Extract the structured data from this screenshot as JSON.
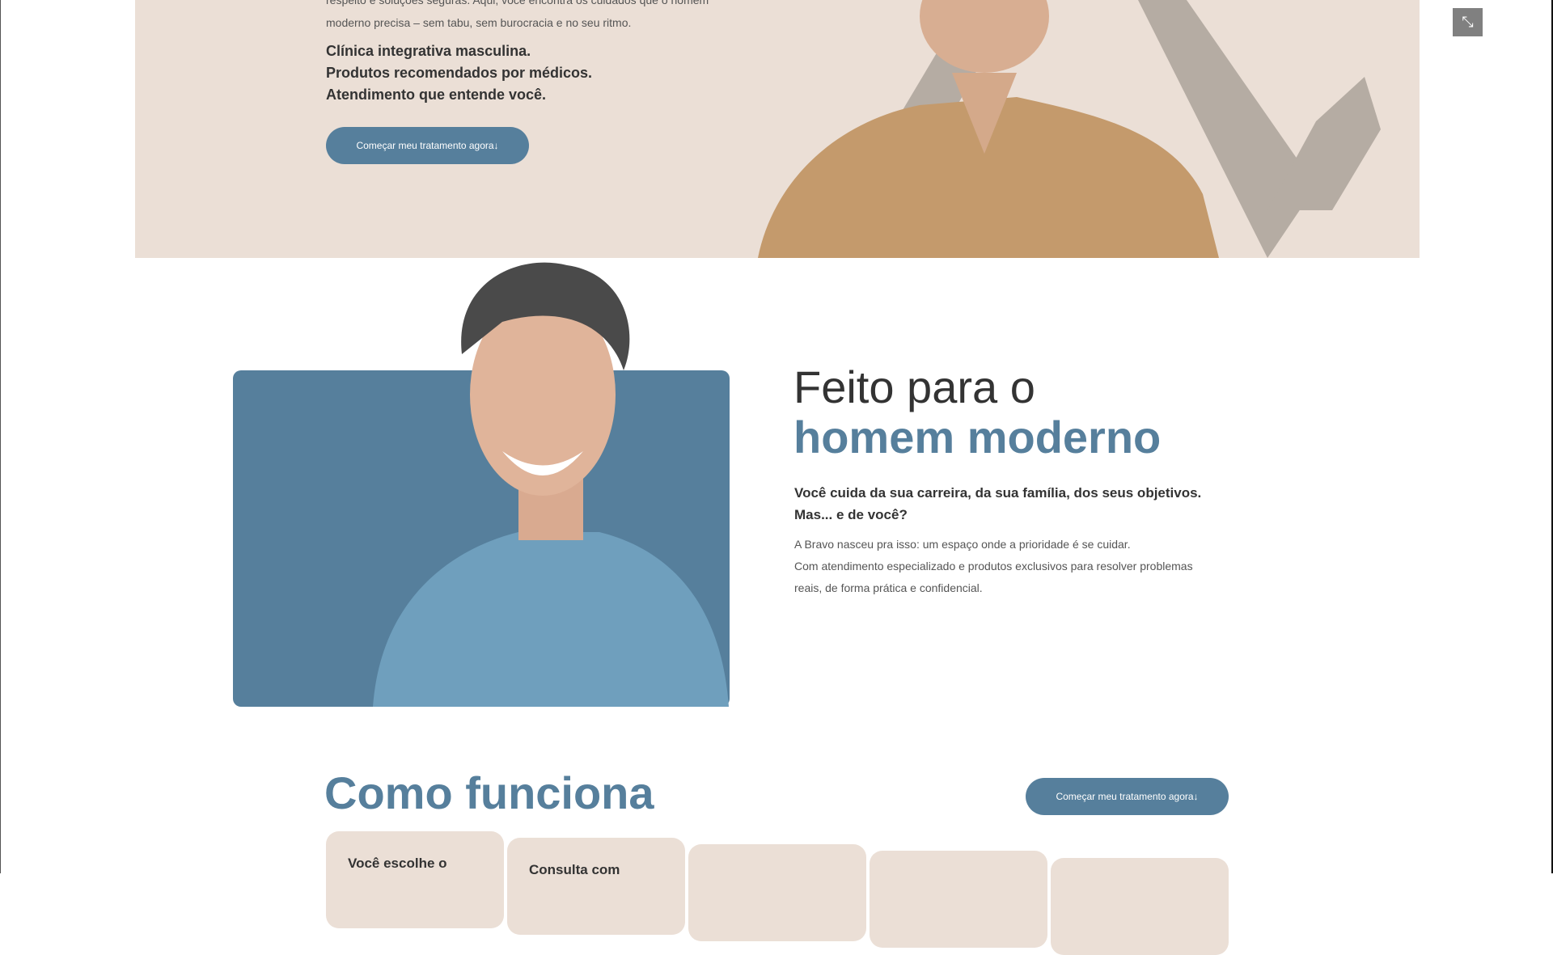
{
  "hero": {
    "intro_lines": [
      "respeito e soluções seguras. Aqui, você encontra os cuidados que o homem",
      "moderno precisa – sem tabu, sem burocracia e no seu ritmo."
    ],
    "highlights": [
      "Clínica integrativa masculina.",
      "Produtos recomendados por médicos.",
      "Atendimento que entende você."
    ],
    "cta": "Começar meu tratamento agora↓"
  },
  "fullscreen_icon": "⤡",
  "about": {
    "title_line1": "Feito para o",
    "title_line2": "homem moderno",
    "subtitle_lines": [
      "Você cuida da sua carreira, da sua família, dos seus objetivos.",
      "Mas... e de você?"
    ],
    "body_lines": [
      "A Bravo nasceu pra isso: um espaço onde a prioridade é se cuidar.",
      "Com atendimento especializado e produtos exclusivos para resolver problemas",
      "reais, de forma prática e confidencial."
    ]
  },
  "how": {
    "title": "Como funciona",
    "cta": "Começar meu tratamento agora↓",
    "cards": [
      "Você escolhe o",
      "Consulta com",
      "",
      "",
      ""
    ]
  },
  "colors": {
    "accent": "#567f9c",
    "beige": "#ebdfd6"
  }
}
